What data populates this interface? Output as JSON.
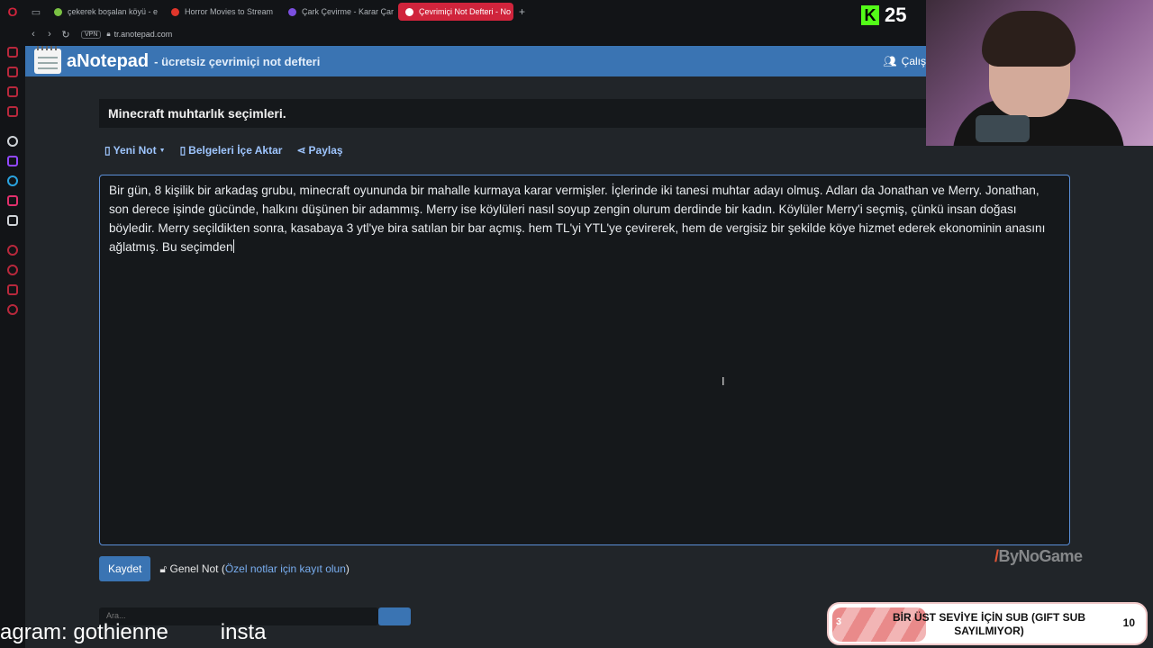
{
  "browser": {
    "tabs": [
      {
        "label": "çekerek boşalan köyü - e",
        "color": "#7ac143"
      },
      {
        "label": "Horror Movies to Stream",
        "color": "#e0362b"
      },
      {
        "label": "Çark Çevirme - Karar Çar",
        "color": "#7b4fe0"
      },
      {
        "label": "Çevrimiçi Not Defteri - No",
        "color": "#ffffff"
      }
    ],
    "active_tab": 3,
    "vpn_label": "VPN",
    "url": "tr.anotepad.com"
  },
  "site": {
    "brand": "aNotepad",
    "tagline": "- ücretsiz çevrimiçi not defteri",
    "header_right": "Çalış"
  },
  "note": {
    "title": "Minecraft muhtarlık seçimleri.",
    "toolbar": {
      "new_note": "Yeni Not",
      "import_docs": "Belgeleri İçe Aktar",
      "share": "Paylaş"
    },
    "body": "Bir gün, 8 kişilik bir arkadaş grubu, minecraft oyununda bir mahalle kurmaya karar vermişler. İçlerinde iki tanesi muhtar adayı olmuş. Adları da Jonathan ve Merry. Jonathan, son derece işinde gücünde, halkını düşünen bir adammış. Merry ise köylüleri nasıl soyup zengin olurum derdinde bir kadın. Köylüler Merry'i seçmiş, çünkü insan doğası böyledir. Merry seçildikten sonra, kasabaya 3 ytl'ye bira satılan bir bar açmış. hem TL'yi YTL'ye çevirerek, hem de vergisiz bir şekilde köye hizmet ederek ekonominin anasını ağlatmış. Bu seçimden",
    "save_label": "Kaydet",
    "visibility_label": "Genel Not (",
    "register_link": "Özel notlar için kayıt olun",
    "visibility_close": ")",
    "search_placeholder": "Ara..."
  },
  "stream": {
    "kick_logo": "K",
    "viewer_count": "25",
    "sponsor": "ByNoGame",
    "sub_goal": {
      "current": "3",
      "text": "BİR ÜST SEVİYE İÇİN SUB (GIFT SUB SAYILMIYOR)",
      "target": "10",
      "progress": 0.3
    },
    "ticker_left": "agram: gothienne",
    "ticker_right": "insta"
  },
  "colors": {
    "accent": "#3a74b3",
    "opera_red": "#d0243c",
    "kick_green": "#53fc18"
  }
}
